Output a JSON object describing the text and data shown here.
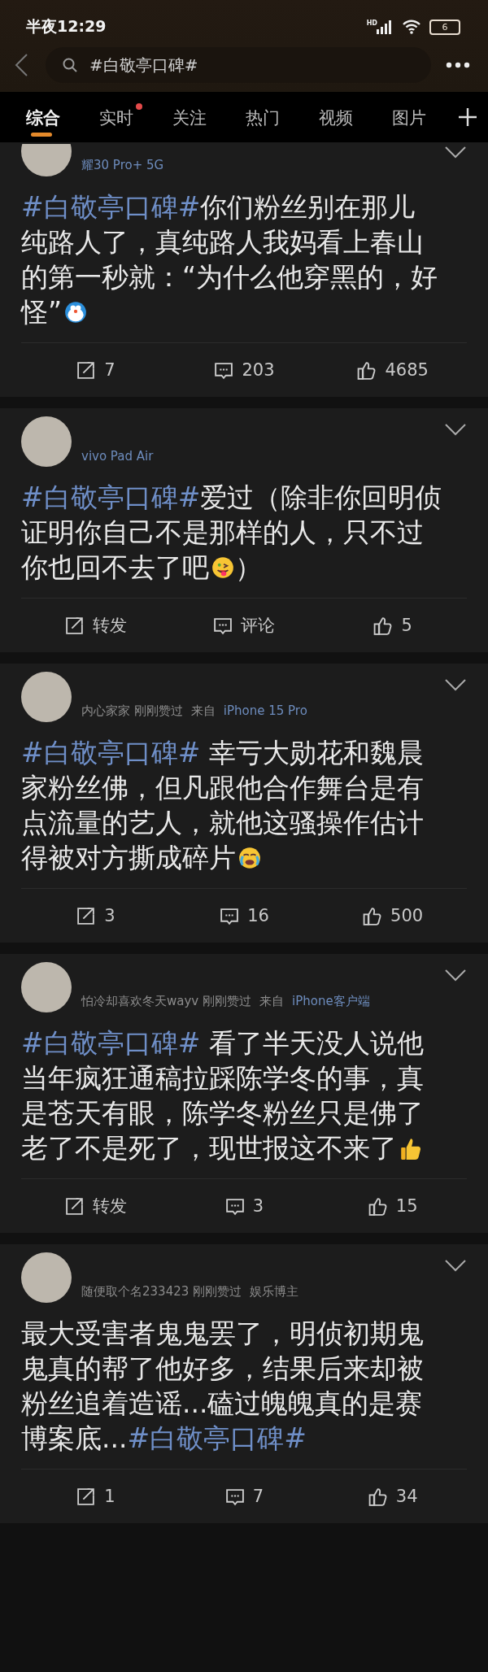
{
  "status_bar": {
    "time": "半夜12:29",
    "network": "HD",
    "battery": "6"
  },
  "search": {
    "query": "#白敬亭口碑#"
  },
  "tabs": [
    {
      "label": "综合",
      "selected": true,
      "dot": false
    },
    {
      "label": "实时",
      "selected": false,
      "dot": true
    },
    {
      "label": "关注",
      "selected": false,
      "dot": false
    },
    {
      "label": "热门",
      "selected": false,
      "dot": false
    },
    {
      "label": "视频",
      "selected": false,
      "dot": false
    },
    {
      "label": "图片",
      "selected": false,
      "dot": false
    }
  ],
  "posts": [
    {
      "cut_top": true,
      "meta": [
        {
          "kind": "source",
          "text": "耀30 Pro+ 5G"
        }
      ],
      "body": [
        [
          {
            "kind": "hashtag",
            "text": "#白敬亭口碑#"
          },
          {
            "kind": "text",
            "text": "你们粉丝别在那儿"
          }
        ],
        [
          {
            "kind": "text",
            "text": "纯路人了，真纯路人我妈看上春山"
          }
        ],
        [
          {
            "kind": "text",
            "text": "的第一秒就：“为什么他穿黑的，好"
          }
        ],
        [
          {
            "kind": "text",
            "text": "怪”"
          },
          {
            "kind": "blueface"
          }
        ]
      ],
      "actions": [
        "7",
        "203",
        "4685"
      ]
    },
    {
      "cut_top": false,
      "meta": [
        {
          "kind": "source",
          "text": "vivo Pad Air"
        }
      ],
      "body": [
        [
          {
            "kind": "hashtag",
            "text": "#白敬亭口碑#"
          },
          {
            "kind": "text",
            "text": "爱过（除非你回明侦"
          }
        ],
        [
          {
            "kind": "text",
            "text": "证明你自己不是那样的人，只不过"
          }
        ],
        [
          {
            "kind": "text",
            "text": "你也回不去了吧"
          },
          {
            "kind": "tongue"
          },
          {
            "kind": "text",
            "text": "）"
          }
        ]
      ],
      "actions": [
        "转发",
        "评论",
        "5"
      ]
    },
    {
      "cut_top": false,
      "meta": [
        {
          "kind": "plain",
          "text": "内心家家 刚刚赞过"
        },
        {
          "kind": "plain",
          "text": "来自"
        },
        {
          "kind": "source",
          "text": "iPhone 15 Pro"
        }
      ],
      "body": [
        [
          {
            "kind": "hashtag",
            "text": "#白敬亭口碑#"
          },
          {
            "kind": "text",
            "text": " 幸亏大勋花和魏晨"
          }
        ],
        [
          {
            "kind": "text",
            "text": "家粉丝佛，但凡跟他合作舞台是有"
          }
        ],
        [
          {
            "kind": "text",
            "text": "点流量的艺人，就他这骚操作估计"
          }
        ],
        [
          {
            "kind": "text",
            "text": "得被对方撕成碎片"
          },
          {
            "kind": "crying"
          }
        ]
      ],
      "actions": [
        "3",
        "16",
        "500"
      ]
    },
    {
      "cut_top": false,
      "meta": [
        {
          "kind": "plain",
          "text": "怕冷却喜欢冬天wayv 刚刚赞过"
        },
        {
          "kind": "plain",
          "text": "来自"
        },
        {
          "kind": "source",
          "text": "iPhone客户端"
        }
      ],
      "body": [
        [
          {
            "kind": "hashtag",
            "text": "#白敬亭口碑#"
          },
          {
            "kind": "text",
            "text": " 看了半天没人说他"
          }
        ],
        [
          {
            "kind": "text",
            "text": "当年疯狂通稿拉踩陈学冬的事，真"
          }
        ],
        [
          {
            "kind": "text",
            "text": "是苍天有眼，陈学冬粉丝只是佛了"
          }
        ],
        [
          {
            "kind": "text",
            "text": "老了不是死了，现世报这不来了"
          },
          {
            "kind": "thumbsup"
          }
        ]
      ],
      "actions": [
        "转发",
        "3",
        "15"
      ]
    },
    {
      "cut_top": false,
      "meta": [
        {
          "kind": "plain",
          "text": "随便取个名233423 刚刚赞过"
        },
        {
          "kind": "plain",
          "text": "娱乐博主"
        }
      ],
      "body": [
        [
          {
            "kind": "text",
            "text": "最大受害者鬼鬼罢了，明侦初期鬼"
          }
        ],
        [
          {
            "kind": "text",
            "text": "鬼真的帮了他好多，结果后来却被"
          }
        ],
        [
          {
            "kind": "text",
            "text": "粉丝追着造谣...磕过魄魄真的是赛"
          }
        ],
        [
          {
            "kind": "text",
            "text": "博案底..."
          },
          {
            "kind": "hashtag",
            "text": "#白敬亭口碑#"
          }
        ]
      ],
      "actions": [
        "1",
        "7",
        "34"
      ]
    }
  ]
}
